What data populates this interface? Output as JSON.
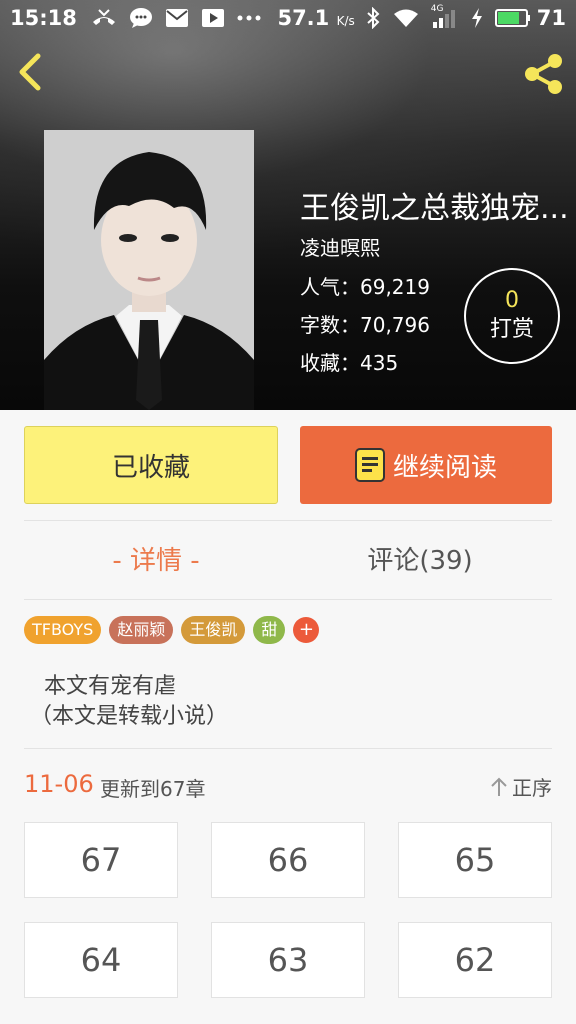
{
  "status_bar": {
    "time": "15:18",
    "speed": "57.1",
    "speed_unit": "K/s",
    "network": "4G",
    "battery": "71",
    "icons": [
      "missed-call-icon",
      "chat-icon",
      "mail-icon",
      "video-icon",
      "more-dots-icon",
      "bluetooth-icon",
      "wifi-icon",
      "signal-icon",
      "charging-icon",
      "battery-icon"
    ]
  },
  "header": {
    "back_icon": "chevron-left-icon",
    "share_icon": "share-icon"
  },
  "book": {
    "title": "王俊凯之总裁独宠...",
    "author": "凌迪暝熙",
    "popularity": "人气：69,219",
    "word_count": "字数：70,796",
    "favorites": "收藏：435"
  },
  "reward": {
    "count": "0",
    "label": "打赏"
  },
  "actions": {
    "favorite_label": "已收藏",
    "read_label": "继续阅读"
  },
  "tabs": {
    "detail": "- 详情 -",
    "comments": "评论(39)"
  },
  "tags": [
    {
      "label": "TFBOYS",
      "color": "#f0a22e"
    },
    {
      "label": "赵丽颖",
      "color": "#c8725a"
    },
    {
      "label": "王俊凯",
      "color": "#d49a3a"
    },
    {
      "label": "甜",
      "color": "#8fb84a"
    }
  ],
  "tag_add": "+",
  "description": {
    "line1": "本文有宠有虐",
    "line2": "（本文是转载小说）"
  },
  "update": {
    "date": "11-06",
    "text": "更新到67章",
    "sort_label": "正序"
  },
  "chapters": [
    "67",
    "66",
    "65",
    "64",
    "63",
    "62"
  ],
  "colors": {
    "accent": "#ec6a3e",
    "favorite_bg": "#fdf27a",
    "reward_number": "#f5e55a"
  }
}
